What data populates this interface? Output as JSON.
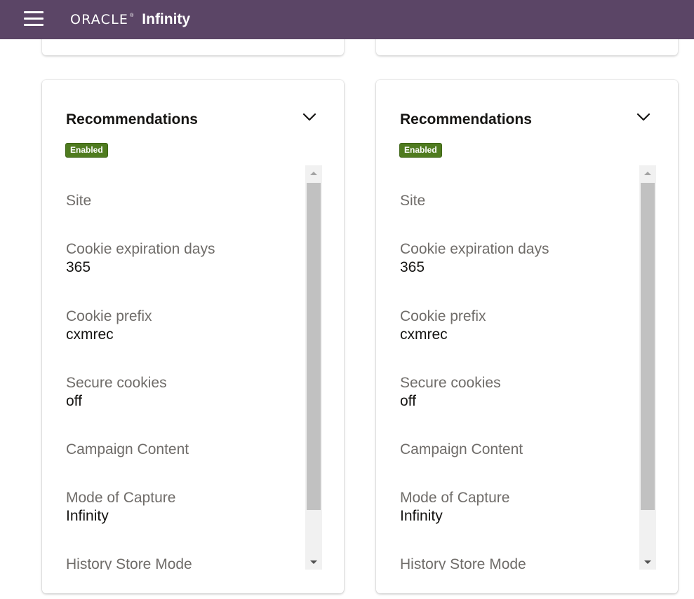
{
  "header": {
    "logo_brand": "ORACLE",
    "logo_reg": "®",
    "logo_product": "Infinity",
    "menu_icon": "hamburger-menu-icon",
    "background_color": "#5b4566"
  },
  "cards": [
    {
      "title": "Recommendations",
      "status_badge": "Enabled",
      "expand_icon": "chevron-down-icon",
      "fields": [
        {
          "label": "Site",
          "value": ""
        },
        {
          "label": "Cookie expiration days",
          "value": "365"
        },
        {
          "label": "Cookie prefix",
          "value": "cxmrec"
        },
        {
          "label": "Secure cookies",
          "value": "off"
        },
        {
          "label": "Campaign Content",
          "value": ""
        },
        {
          "label": "Mode of Capture",
          "value": "Infinity"
        },
        {
          "label": "History Store Mode",
          "value": ""
        }
      ]
    },
    {
      "title": "Recommendations",
      "status_badge": "Enabled",
      "expand_icon": "chevron-down-icon",
      "fields": [
        {
          "label": "Site",
          "value": ""
        },
        {
          "label": "Cookie expiration days",
          "value": "365"
        },
        {
          "label": "Cookie prefix",
          "value": "cxmrec"
        },
        {
          "label": "Secure cookies",
          "value": "off"
        },
        {
          "label": "Campaign Content",
          "value": ""
        },
        {
          "label": "Mode of Capture",
          "value": "Infinity"
        },
        {
          "label": "History Store Mode",
          "value": ""
        }
      ]
    }
  ],
  "colors": {
    "badge_green": "#4f7b1f",
    "label_gray": "#6f6c69",
    "value_dark": "#161513"
  }
}
